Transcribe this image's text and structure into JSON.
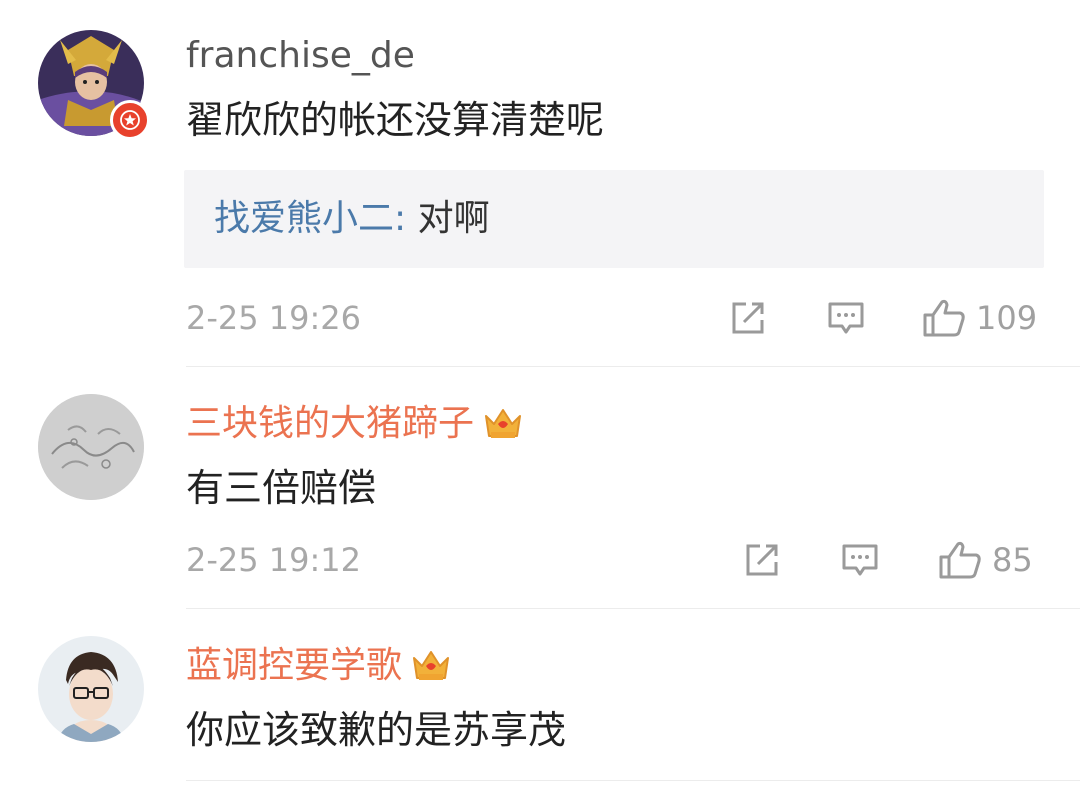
{
  "comments": [
    {
      "username": "franchise_de",
      "text": "翟欣欣的帐还没算清楚呢",
      "reply": {
        "user": "找爱熊小二",
        "separator": ":",
        "text": "对啊"
      },
      "timestamp": "2-25 19:26",
      "likes": "109",
      "avatar_icon": "armored-warrior-avatar",
      "badge_icon": "verified-star-badge-icon"
    },
    {
      "username": "三块钱的大猪蹄子",
      "text": "有三倍赔偿",
      "timestamp": "2-25 19:12",
      "likes": "85",
      "vip_icon": "crown-icon",
      "avatar_icon": "grey-sketch-avatar"
    },
    {
      "username": "蓝调控要学歌",
      "text": "你应该致歉的是苏享茂",
      "vip_icon": "crown-icon",
      "avatar_icon": "anime-boy-glasses-avatar"
    }
  ],
  "icons": {
    "share": "share-icon",
    "reply": "comment-icon",
    "like": "thumbs-up-icon"
  },
  "colors": {
    "vip_username": "#eb7350",
    "reply_user": "#4b7aaa",
    "meta_gray": "#a8a8a8"
  }
}
